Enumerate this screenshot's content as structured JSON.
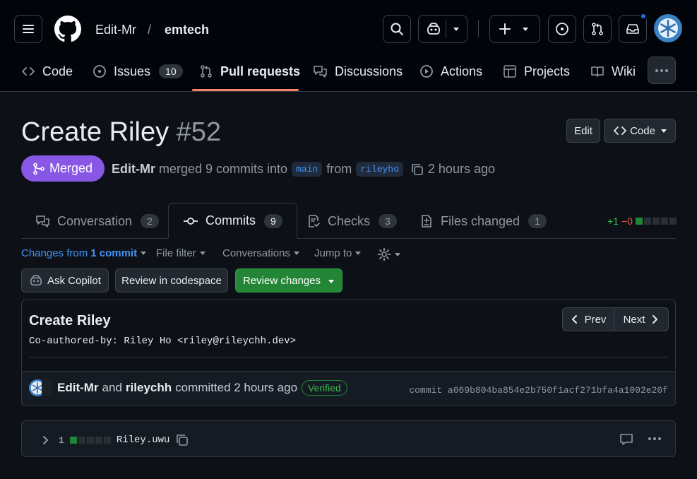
{
  "header": {
    "owner": "Edit-Mr",
    "separator": "/",
    "repo": "emtech"
  },
  "nav": {
    "code": "Code",
    "issues": "Issues",
    "issues_count": "10",
    "pull_requests": "Pull requests",
    "discussions": "Discussions",
    "actions": "Actions",
    "projects": "Projects",
    "wiki": "Wiki"
  },
  "pr": {
    "title": "Create Riley",
    "number": "#52",
    "edit_label": "Edit",
    "code_label": "Code",
    "state": "Merged",
    "author": "Edit-Mr",
    "merged_text": "merged 9 commits into",
    "base_branch": "main",
    "from_text": "from",
    "head_branch": "rileyho",
    "time": "2 hours ago"
  },
  "tabs": [
    {
      "label": "Conversation",
      "count": "2"
    },
    {
      "label": "Commits",
      "count": "9"
    },
    {
      "label": "Checks",
      "count": "3"
    },
    {
      "label": "Files changed",
      "count": "1"
    }
  ],
  "diffstat": {
    "additions": "+1",
    "deletions": "−0"
  },
  "filters": {
    "changes_from": "Changes from",
    "commit_count": "1 commit",
    "file_filter": "File filter",
    "conversations": "Conversations",
    "jump_to": "Jump to"
  },
  "actions": {
    "ask_copilot": "Ask Copilot",
    "review_codespace": "Review in codespace",
    "review_changes": "Review changes"
  },
  "commit": {
    "title": "Create Riley",
    "body": "Co-authored-by: Riley Ho <riley@rileychh.dev>",
    "prev": "Prev",
    "next": "Next",
    "author1": "Edit-Mr",
    "and": "and",
    "author2": "rileychh",
    "committed_text": "committed 2 hours ago",
    "verified": "Verified",
    "sha_label": "commit a069b804ba854e2b750f1acf271bfa4a1002e20f"
  },
  "file": {
    "changes": "1",
    "name": "Riley.uwu"
  },
  "colors": {
    "bg": "#0d1117",
    "header_bg": "#010409",
    "merged": "#8957e5",
    "accent_blue": "#4493f8",
    "green": "#238636",
    "tab_underline": "#f78166"
  }
}
